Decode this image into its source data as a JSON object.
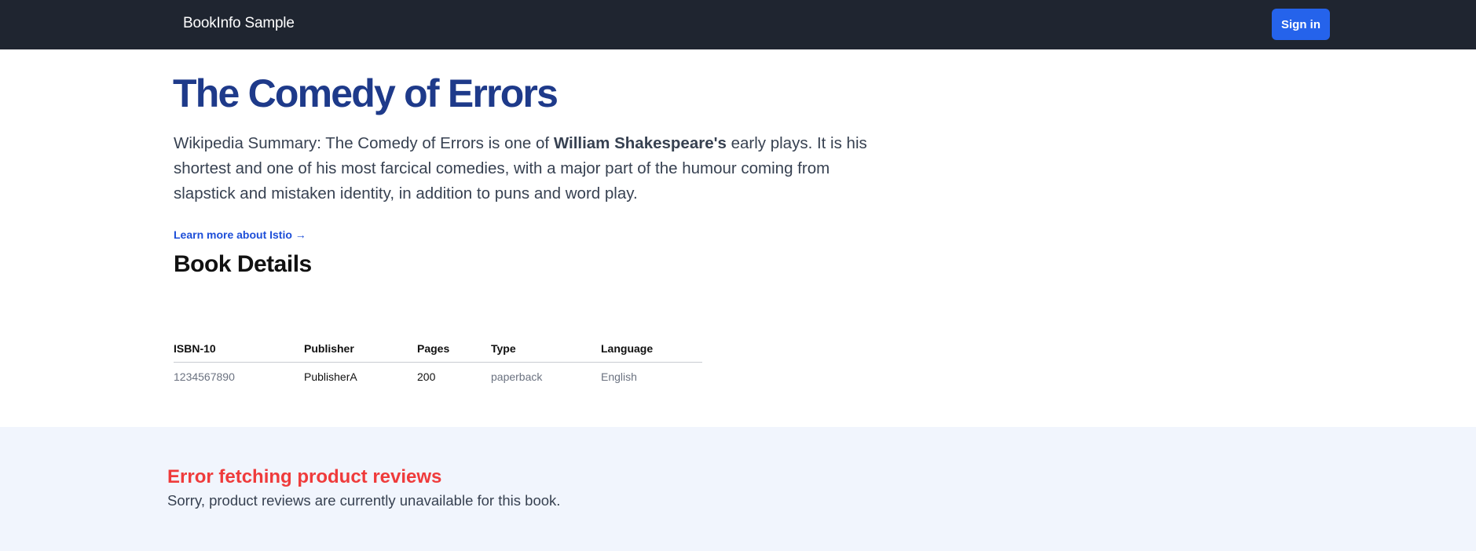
{
  "navbar": {
    "brand": "BookInfo Sample",
    "signin_label": "Sign in"
  },
  "book": {
    "title": "The Comedy of Errors",
    "summary_prefix": "Wikipedia Summary: The Comedy of Errors is one of ",
    "summary_author": "William Shakespeare's",
    "summary_suffix": " early plays. It is his shortest and one of his most farcical comedies, with a major part of the humour coming from slapstick and mistaken identity, in addition to puns and word play.",
    "learn_more": "Learn more about Istio →"
  },
  "details": {
    "heading": "Book Details",
    "columns": [
      "ISBN-10",
      "Publisher",
      "Pages",
      "Type",
      "Language"
    ],
    "row": [
      "1234567890",
      "PublisherA",
      "200",
      "paperback",
      "English"
    ]
  },
  "reviews": {
    "error_title": "Error fetching product reviews",
    "error_message": "Sorry, product reviews are currently unavailable for this book."
  },
  "colors": {
    "navbar_bg": "#1f2530",
    "accent": "#2563eb",
    "title": "#1e3a8a",
    "error": "#ef3b3b",
    "reviews_bg": "#f1f5fd"
  }
}
